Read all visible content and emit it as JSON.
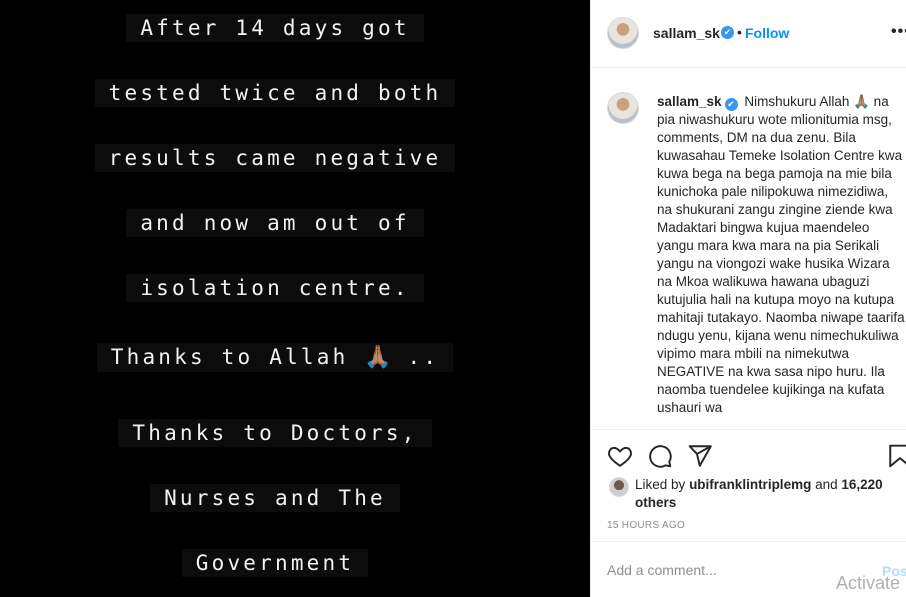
{
  "media": {
    "lines": [
      "After 14 days got",
      "tested twice and both",
      "results came negative",
      "and now am out of",
      "isolation centre.",
      "Thanks to Allah",
      "..",
      "Thanks to Doctors,",
      "Nurses and The",
      "Government"
    ],
    "prayer_emoji": "🙏🏽"
  },
  "header": {
    "username": "sallam_sk",
    "verified_glyph": "✔",
    "separator": "•",
    "follow_label": "Follow",
    "more_glyph": "•••"
  },
  "caption": {
    "username": "sallam_sk",
    "verified_glyph": "✔",
    "text": "Nimshukuru Allah 🙏🏽 na pia niwashukuru wote mlionitumia msg, comments, DM na dua zenu. Bila kuwasahau Temeke Isolation Centre kwa kuwa bega na bega pamoja na mie bila kunichoka pale nilipokuwa nimezidiwa, na shukurani zangu zingine ziende kwa Madaktari bingwa kujua maendeleo yangu mara kwa mara na pia Serikali yangu na viongozi wake husika Wizara na Mkoa walikuwa hawana ubaguzi kutujulia hali na kutupa moyo na kutupa mahitaji tutakayo. Naomba niwape taarifa ndugu yenu, kijana wenu nimechukuliwa vipimo mara mbili na nimekutwa NEGATIVE na kwa sasa nipo huru. Ila naomba tuendelee kujikinga na kufata ushauri wa"
  },
  "likes": {
    "prefix": "Liked by",
    "liker": "ubifranklintriplemg",
    "conjunction": "and",
    "others": "16,220 others"
  },
  "timestamp": "15 HOURS AGO",
  "comment_box": {
    "placeholder": "Add a comment...",
    "post_label": "Post"
  },
  "watermark": "Activate",
  "colors": {
    "accent": "#0095f6",
    "verified": "#3897f0",
    "post_disabled": "#b3dbff",
    "muted": "#8e8e8e",
    "media_background": "#000000"
  }
}
